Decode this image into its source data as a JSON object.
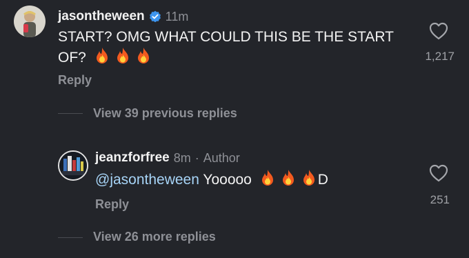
{
  "comment": {
    "username": "jasontheween",
    "verified": true,
    "time": "11m",
    "text_line1": "START? OMG WHAT COULD THIS BE THE START",
    "text_line2": "OF?",
    "emoji": [
      "fire",
      "fire",
      "fire"
    ],
    "reply_label": "Reply",
    "likes": "1,217"
  },
  "view_previous": "View 39 previous replies",
  "reply_item": {
    "username": "jeanzforfree",
    "time": "8m",
    "separator": "·",
    "author_tag": "Author",
    "mention": "@jasontheween",
    "text": "Yooooo",
    "emoji": [
      "fire",
      "fire",
      "fire"
    ],
    "trailing": "D",
    "reply_label": "Reply",
    "likes": "251"
  },
  "view_more": "View 26 more replies",
  "colors": {
    "background": "#23252a",
    "verified": "#3d95ef",
    "mention": "#a7d4f7",
    "muted": "#8e9096"
  },
  "icons": [
    "heart-icon",
    "verified-badge-icon",
    "fire-emoji"
  ]
}
